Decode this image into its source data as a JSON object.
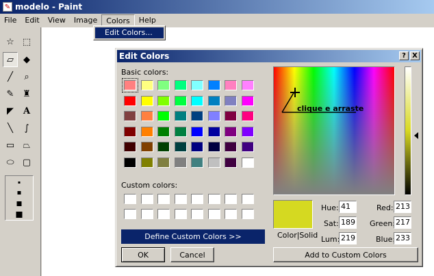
{
  "window": {
    "title": "modelo - Paint"
  },
  "menubar": [
    "File",
    "Edit",
    "View",
    "Image",
    "Colors",
    "Help"
  ],
  "dropdown": {
    "item": "Edit Colors..."
  },
  "dialog": {
    "title": "Edit Colors",
    "help_button": "?",
    "close_button": "X",
    "basic_colors_label": "Basic colors:",
    "custom_colors_label": "Custom colors:",
    "basic_colors": [
      "#ff8080",
      "#ffff80",
      "#80ff80",
      "#00ff80",
      "#80ffff",
      "#0080ff",
      "#ff80c0",
      "#ff80ff",
      "#ff0000",
      "#ffff00",
      "#80ff00",
      "#00ff40",
      "#00ffff",
      "#0080c0",
      "#8080c0",
      "#ff00ff",
      "#804040",
      "#ff8040",
      "#00ff00",
      "#008080",
      "#004080",
      "#8080ff",
      "#800040",
      "#ff0080",
      "#800000",
      "#ff8000",
      "#008000",
      "#008040",
      "#0000ff",
      "#0000a0",
      "#800080",
      "#8000ff",
      "#400000",
      "#804000",
      "#004000",
      "#004040",
      "#000080",
      "#000040",
      "#400040",
      "#400080",
      "#000000",
      "#808000",
      "#808040",
      "#808080",
      "#408080",
      "#c0c0c0",
      "#400040",
      "#ffffff"
    ],
    "selected_swatch_index": 0,
    "define_button": "Define Custom Colors >>",
    "ok_button": "OK",
    "cancel_button": "Cancel",
    "annotation": "clique e arraste",
    "color_solid_label": "Color|Solid",
    "current_color": "#d5d921",
    "hue_label": "Hue:",
    "hue": "41",
    "sat_label": "Sat:",
    "sat": "189",
    "lum_label": "Lum:",
    "lum": "219",
    "red_label": "Red:",
    "red": "213",
    "green_label": "Green:",
    "green": "217",
    "blue_label": "Blue:",
    "blue": "233",
    "add_custom_button": "Add to Custom Colors"
  },
  "colors": {
    "titlebar_start": "#0a246a",
    "titlebar_end": "#a6caf0",
    "face": "#d4d0c8"
  },
  "tools": [
    "free-form-select-icon",
    "rect-select-icon",
    "eraser-icon",
    "fill-icon",
    "color-picker-icon",
    "magnifier-icon",
    "pencil-icon",
    "brush-icon",
    "airbrush-icon",
    "text-icon",
    "line-icon",
    "curve-icon",
    "rectangle-icon",
    "polygon-icon",
    "ellipse-icon",
    "rounded-rect-icon"
  ]
}
